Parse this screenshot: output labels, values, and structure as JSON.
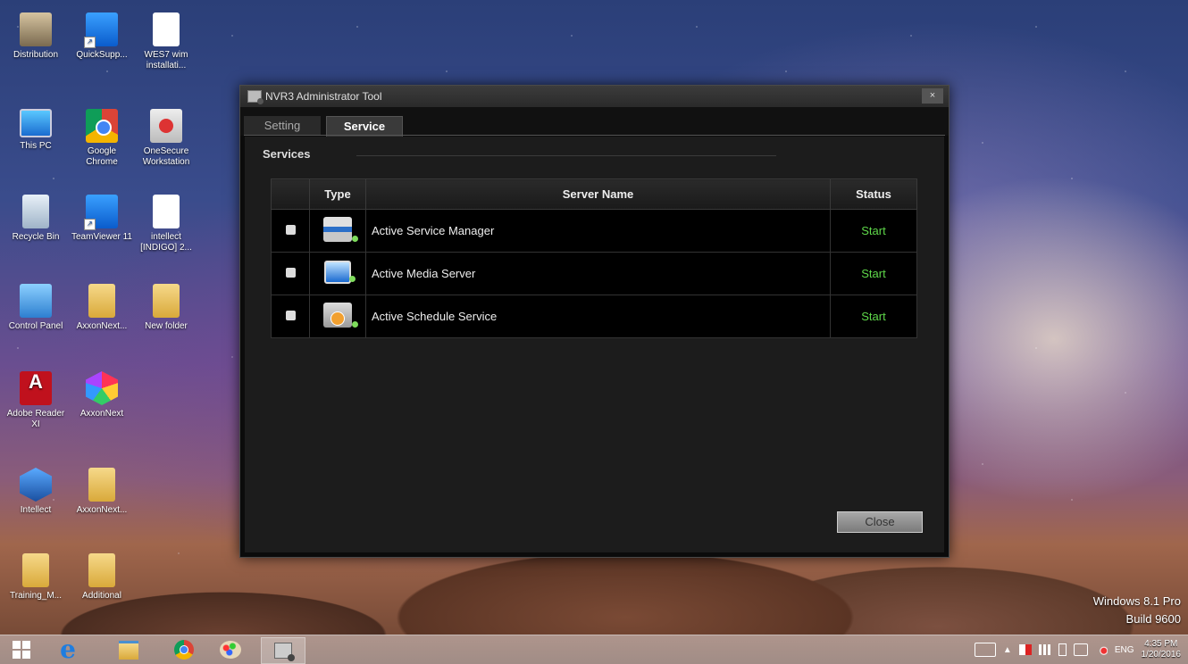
{
  "desktop": {
    "icons": [
      {
        "label": "Distribution",
        "icon": "user-folder-icon"
      },
      {
        "label": "QuickSupp...",
        "icon": "teamviewer-icon"
      },
      {
        "label": "WES7 wim installati...",
        "icon": "document-icon"
      },
      {
        "label": "This PC",
        "icon": "computer-icon"
      },
      {
        "label": "Google Chrome",
        "icon": "chrome-icon"
      },
      {
        "label": "OneSecure Workstation",
        "icon": "eye-icon"
      },
      {
        "label": "Recycle Bin",
        "icon": "recycle-bin-icon"
      },
      {
        "label": "TeamViewer 11",
        "icon": "teamviewer-icon"
      },
      {
        "label": "intellect [INDIGO] 2...",
        "icon": "document-icon"
      },
      {
        "label": "Control Panel",
        "icon": "control-panel-icon"
      },
      {
        "label": "AxxonNext...",
        "icon": "folder-icon"
      },
      {
        "label": "New folder",
        "icon": "folder-icon"
      },
      {
        "label": "Adobe Reader XI",
        "icon": "adobe-reader-icon"
      },
      {
        "label": "AxxonNext",
        "icon": "axxonnext-icon"
      },
      {
        "label": "Intellect",
        "icon": "intellect-icon"
      },
      {
        "label": "AxxonNext...",
        "icon": "folder-icon"
      },
      {
        "label": "Training_M...",
        "icon": "folder-icon"
      },
      {
        "label": "Additional",
        "icon": "folder-icon"
      }
    ]
  },
  "window": {
    "title": "NVR3 Administrator Tool",
    "close_glyph": "×",
    "tabs": [
      {
        "label": "Setting",
        "active": false
      },
      {
        "label": "Service",
        "active": true
      }
    ],
    "section_label": "Services",
    "table": {
      "headers": [
        "",
        "Type",
        "Server Name",
        "Status"
      ],
      "rows": [
        {
          "checked": false,
          "type_icon": "service-manager-icon",
          "name": "Active Service Manager",
          "status": "Start"
        },
        {
          "checked": false,
          "type_icon": "media-server-icon",
          "name": "Active Media Server",
          "status": "Start"
        },
        {
          "checked": false,
          "type_icon": "schedule-service-icon",
          "name": "Active Schedule Service",
          "status": "Start"
        }
      ]
    },
    "close_button": "Close"
  },
  "watermark": {
    "line1": "Windows 8.1 Pro",
    "line2": "Build 9600"
  },
  "taskbar": {
    "apps": [
      "start-icon",
      "internet-explorer-icon",
      "file-explorer-icon",
      "chrome-icon",
      "paint-icon",
      "nvr3-admin-icon"
    ],
    "tray": {
      "language": "ENG",
      "time": "4:35 PM",
      "date": "1/20/2016"
    }
  },
  "colors": {
    "status_green": "#5fd84a",
    "window_bg": "#0b0b0b"
  }
}
